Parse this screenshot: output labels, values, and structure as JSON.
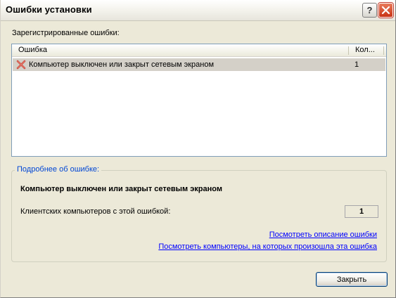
{
  "window": {
    "title": "Ошибки установки",
    "help_label": "?",
    "close_label": "✕"
  },
  "errors_list": {
    "label": "Зарегистрированные ошибки:",
    "columns": [
      "Ошибка",
      "Кол..."
    ],
    "rows": [
      {
        "icon": "error-x-icon",
        "error": "Компьютер выключен или закрыт сетевым экраном",
        "count": "1"
      }
    ]
  },
  "details": {
    "legend": "Подробнее об ошибке:",
    "title": "Компьютер выключен или закрыт сетевым экраном",
    "clients_label": "Клиентских компьютеров с этой ошибкой:",
    "clients_count": "1",
    "link_description": "Посмотреть описание ошибки",
    "link_computers": "Посмотреть компьютеры, на которых произошла эта ошибка"
  },
  "footer": {
    "close_button": "Закрыть"
  },
  "colors": {
    "link": "#0000ff",
    "legend": "#0046d5",
    "selection": "#d4d0c8",
    "window_bg": "#ece9d8"
  }
}
